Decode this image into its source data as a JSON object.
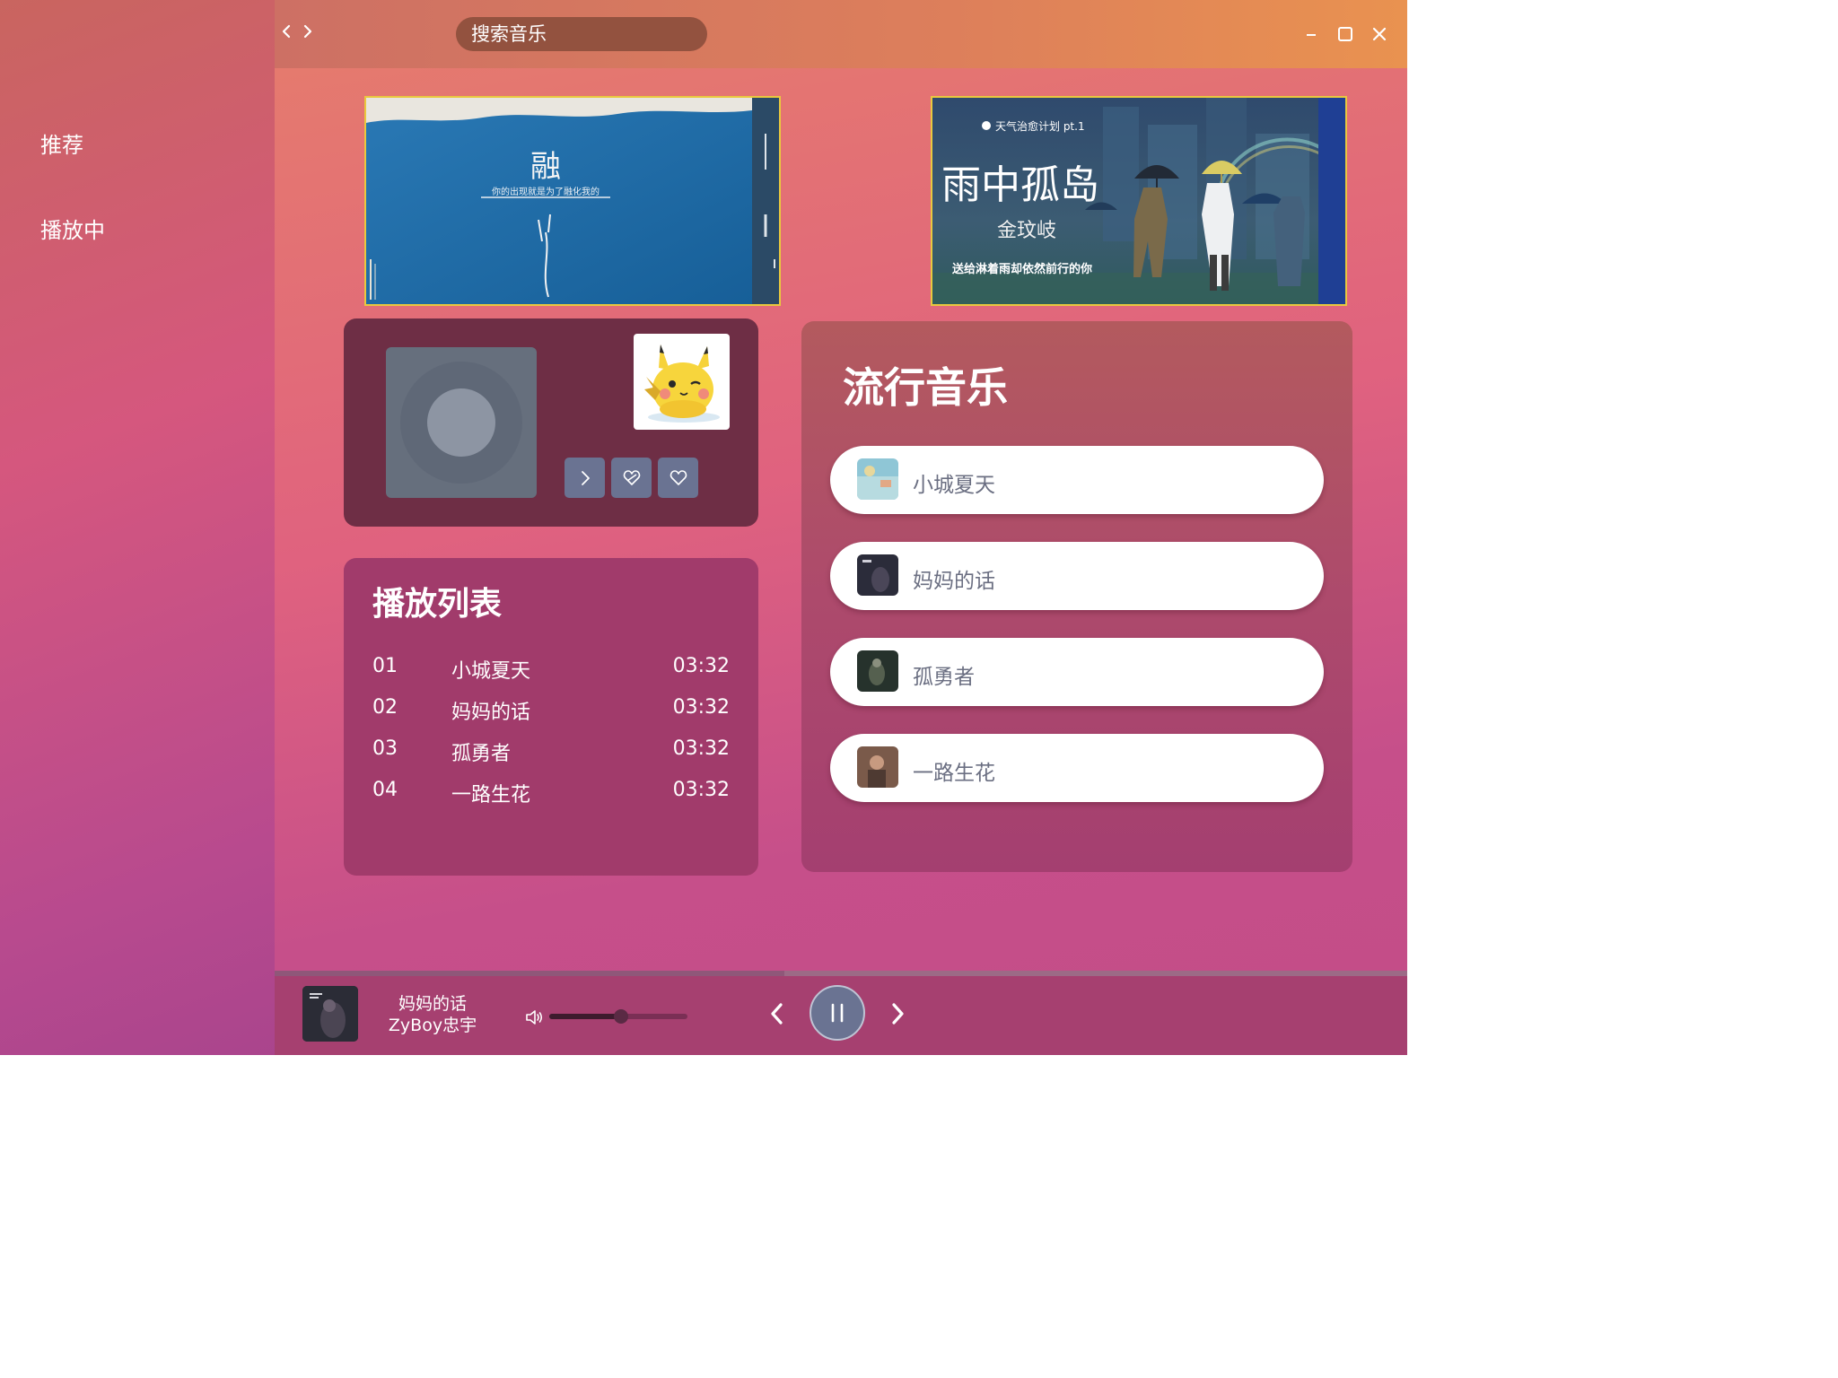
{
  "header": {
    "search_placeholder": "搜索音乐",
    "back_icon": "chevron-left-icon",
    "forward_icon": "chevron-right-icon",
    "window_controls": [
      "minimize-icon",
      "maximize-icon",
      "close-icon"
    ]
  },
  "sidebar": {
    "items": [
      {
        "label": "推荐"
      },
      {
        "label": "播放中"
      }
    ]
  },
  "banners": [
    {
      "title": "融",
      "subtitle": "你的出现就是为了融化我的"
    },
    {
      "tag": "天气治愈计划 pt.1",
      "title": "雨中孤岛",
      "artist": "金玟岐",
      "caption": "送给淋着雨却依然前行的你"
    }
  ],
  "player_card": {
    "buttons": [
      "chevron-right-icon",
      "heart-broken-icon",
      "heart-icon"
    ]
  },
  "playlist": {
    "title": "播放列表",
    "rows": [
      {
        "no": "01",
        "title": "小城夏天",
        "duration": "03:32"
      },
      {
        "no": "02",
        "title": "妈妈的话",
        "duration": "03:32"
      },
      {
        "no": "03",
        "title": "孤勇者",
        "duration": "03:32"
      },
      {
        "no": "04",
        "title": "一路生花",
        "duration": "03:32"
      }
    ]
  },
  "popular": {
    "title": "流行音乐",
    "songs": [
      {
        "title": "小城夏天"
      },
      {
        "title": "妈妈的话"
      },
      {
        "title": "孤勇者"
      },
      {
        "title": "一路生花"
      }
    ]
  },
  "now_playing": {
    "title": "妈妈的话",
    "artist": "ZyBoy忠宇",
    "progress": 0.45,
    "volume": 0.52
  },
  "colors": {
    "accent_button": "#6a7392",
    "banner_border": "#e9c83e"
  }
}
